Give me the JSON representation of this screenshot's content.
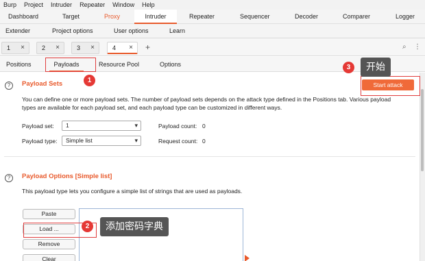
{
  "menu": [
    "Burp",
    "Project",
    "Intruder",
    "Repeater",
    "Window",
    "Help"
  ],
  "tabs_row1": [
    "Dashboard",
    "Target",
    "Proxy",
    "Intruder",
    "Repeater",
    "Sequencer",
    "Decoder",
    "Comparer",
    "Logger"
  ],
  "tabs_row2": [
    "Extender",
    "Project options",
    "User options",
    "Learn"
  ],
  "attack_tabs": [
    {
      "label": "1",
      "close": "×"
    },
    {
      "label": "2",
      "close": "×"
    },
    {
      "label": "3",
      "close": "×"
    },
    {
      "label": "4",
      "close": "×"
    }
  ],
  "add_tab": "+",
  "toolbar_icons": {
    "search": "⌕",
    "more": "⋮"
  },
  "intruder_tabs": [
    "Positions",
    "Payloads",
    "Resource Pool",
    "Options"
  ],
  "payload_sets": {
    "help": "?",
    "title": "Payload Sets",
    "description": "You can define one or more payload sets. The number of payload sets depends on the attack type defined in the Positions tab. Various payload types are available for each payload set, and each payload type can be customized in different ways.",
    "set_label": "Payload set:",
    "set_value": "1",
    "type_label": "Payload type:",
    "type_value": "Simple list",
    "count_label": "Payload count:",
    "count_value": "0",
    "request_label": "Request count:",
    "request_value": "0"
  },
  "start_attack": "Start attack",
  "payload_options": {
    "help": "?",
    "title": "Payload Options [Simple list]",
    "description": "This payload type lets you configure a simple list of strings that are used as payloads.",
    "buttons": [
      "Paste",
      "Load ...",
      "Remove",
      "Clear"
    ]
  },
  "annotations": {
    "badge1": "1",
    "badge2": "2",
    "badge3": "3",
    "tip2": "添加密码字典",
    "tip3": "开始"
  },
  "colors": {
    "accent": "#e8592b",
    "button": "#f06a39",
    "annotation": "#e53935",
    "tooltip": "#555555"
  }
}
